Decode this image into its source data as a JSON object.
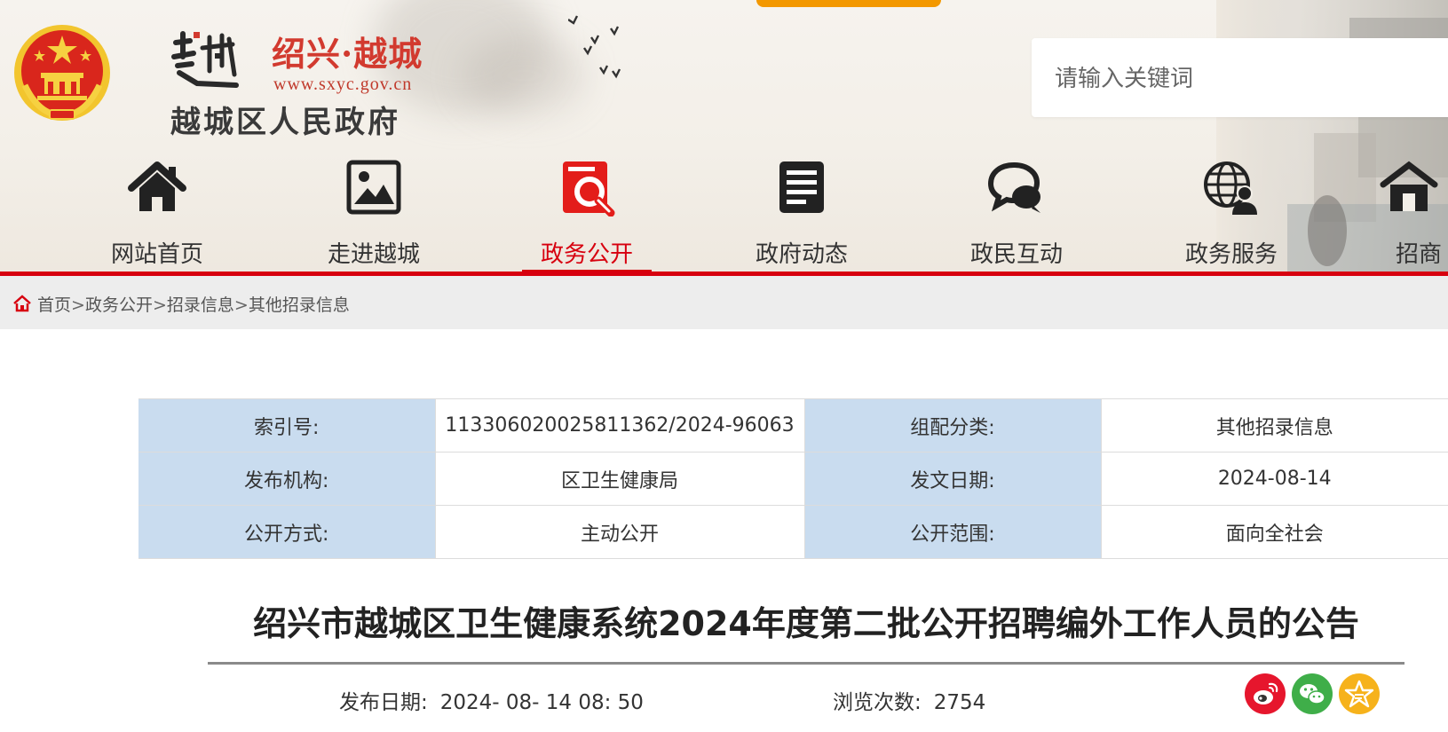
{
  "site": {
    "city_name": "绍兴·越城",
    "url": "www.sxyc.gov.cn",
    "gov_name": "越城区人民政府",
    "logo_mark_icon": "yuecheng-calligraphy-logo",
    "emblem_icon": "national-emblem-icon"
  },
  "search": {
    "placeholder": "请输入关键词",
    "value": ""
  },
  "nav": {
    "items": [
      {
        "label": "网站首页",
        "icon": "home-icon",
        "active": false
      },
      {
        "label": "走进越城",
        "icon": "picture-icon",
        "active": false
      },
      {
        "label": "政务公开",
        "icon": "document-search-icon",
        "active": true
      },
      {
        "label": "政府动态",
        "icon": "news-list-icon",
        "active": false
      },
      {
        "label": "政民互动",
        "icon": "chat-bubbles-icon",
        "active": false
      },
      {
        "label": "政务服务",
        "icon": "globe-user-icon",
        "active": false
      },
      {
        "label": "招商",
        "icon": "building-icon",
        "active": false
      }
    ],
    "active_color": "#d7000f"
  },
  "breadcrumb": {
    "items": [
      "首页",
      "政务公开",
      "招录信息",
      "其他招录信息"
    ],
    "separator": ">"
  },
  "info": {
    "rows": [
      [
        {
          "k": "索引号:",
          "v": "113306020025811362/2024-96063"
        },
        {
          "k": "组配分类:",
          "v": "其他招录信息"
        }
      ],
      [
        {
          "k": "发布机构:",
          "v": "区卫生健康局"
        },
        {
          "k": "发文日期:",
          "v": "2024-08-14"
        }
      ],
      [
        {
          "k": "公开方式:",
          "v": "主动公开"
        },
        {
          "k": "公开范围:",
          "v": "面向全社会"
        }
      ]
    ],
    "key_bg": "#c9dcef"
  },
  "article": {
    "title": "绍兴市越城区卫生健康系统2024年度第二批公开招聘编外工作人员的公告",
    "publish_label": "发布日期:",
    "publish_value": "2024- 08- 14 08: 50",
    "views_label": "浏览次数:",
    "views_value": "2754"
  },
  "share": {
    "icons": [
      "weibo-icon",
      "wechat-icon",
      "favorite-star-icon"
    ],
    "colors": [
      "#e6162d",
      "#3fae49",
      "#f6b21b"
    ]
  }
}
